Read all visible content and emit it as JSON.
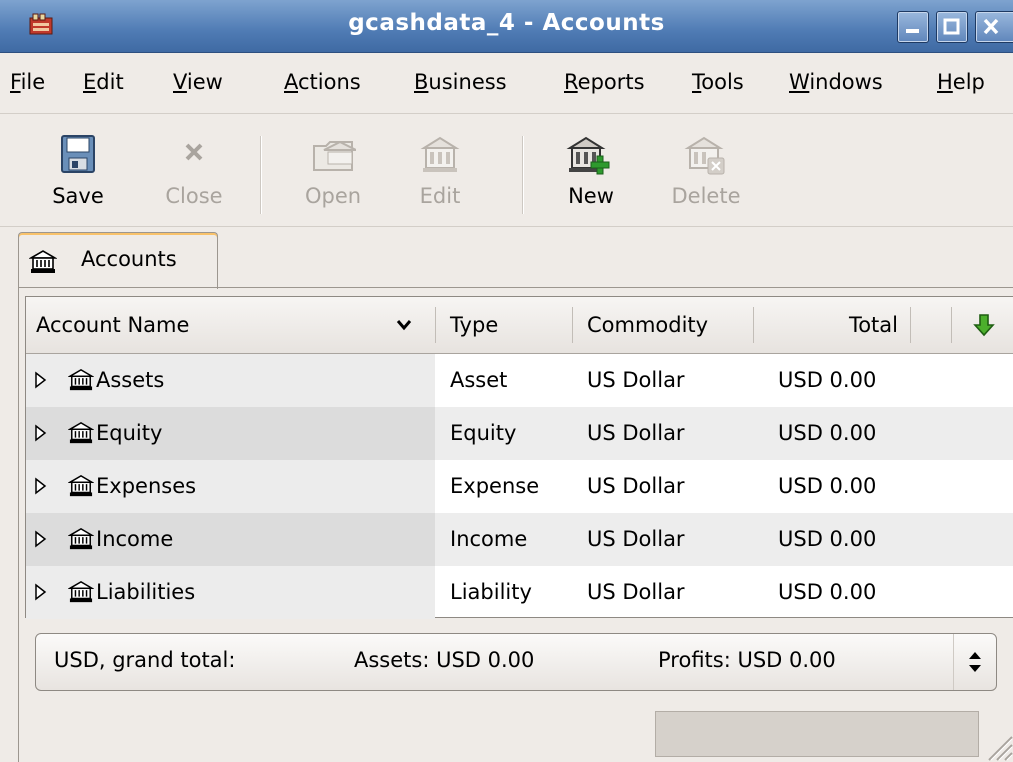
{
  "window": {
    "title": "gcashdata_4 - Accounts",
    "controls": [
      "minimize",
      "maximize",
      "close"
    ]
  },
  "menubar": {
    "items": [
      {
        "label": "File",
        "mnemonic": "F"
      },
      {
        "label": "Edit",
        "mnemonic": "E"
      },
      {
        "label": "View",
        "mnemonic": "V"
      },
      {
        "label": "Actions",
        "mnemonic": "A"
      },
      {
        "label": "Business",
        "mnemonic": "B"
      },
      {
        "label": "Reports",
        "mnemonic": "R"
      },
      {
        "label": "Tools",
        "mnemonic": "T"
      },
      {
        "label": "Windows",
        "mnemonic": "W"
      },
      {
        "label": "Help",
        "mnemonic": "H"
      }
    ]
  },
  "toolbar": {
    "buttons": [
      {
        "label": "Save",
        "icon": "save-icon",
        "enabled": true
      },
      {
        "label": "Close",
        "icon": "close-icon",
        "enabled": false
      },
      {
        "label": "Open",
        "icon": "open-account-icon",
        "enabled": false
      },
      {
        "label": "Edit",
        "icon": "edit-account-icon",
        "enabled": false
      },
      {
        "label": "New",
        "icon": "new-account-icon",
        "enabled": true
      },
      {
        "label": "Delete",
        "icon": "delete-account-icon",
        "enabled": false
      }
    ]
  },
  "tabs": [
    {
      "label": "Accounts",
      "icon": "bank-icon",
      "active": true
    }
  ],
  "accounts_table": {
    "columns": {
      "name": "Account Name",
      "type": "Type",
      "commodity": "Commodity",
      "total": "Total"
    },
    "rows": [
      {
        "name": "Assets",
        "type": "Asset",
        "commodity": "US Dollar",
        "total": "USD 0.00"
      },
      {
        "name": "Equity",
        "type": "Equity",
        "commodity": "US Dollar",
        "total": "USD 0.00"
      },
      {
        "name": "Expenses",
        "type": "Expense",
        "commodity": "US Dollar",
        "total": "USD 0.00"
      },
      {
        "name": "Income",
        "type": "Income",
        "commodity": "US Dollar",
        "total": "USD 0.00"
      },
      {
        "name": "Liabilities",
        "type": "Liability",
        "commodity": "US Dollar",
        "total": "USD 0.00"
      }
    ]
  },
  "summary": {
    "currency_label": "USD, grand total:",
    "assets": "Assets: USD 0.00",
    "profits": "Profits: USD 0.00"
  },
  "colors": {
    "titlebar": "#4f7bb4",
    "window_bg": "#efebe7",
    "row_alt": "#dcdcdc"
  }
}
